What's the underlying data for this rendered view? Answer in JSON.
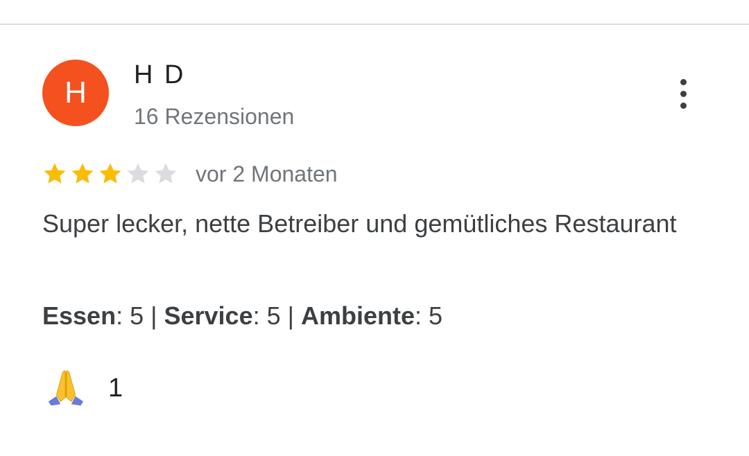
{
  "review": {
    "author": {
      "initial": "H",
      "name": "H D",
      "review_count": "16 Rezensionen",
      "avatar_color": "#f4511e"
    },
    "menu_icon": "more-vert-icon",
    "rating": {
      "value": 3,
      "max": 5,
      "filled_color": "#fbbc04",
      "empty_color": "#dadce0"
    },
    "relative_time": "vor 2 Monaten",
    "text": "Super lecker, nette Betreiber und gemütliches Restaurant",
    "sub_ratings": [
      {
        "label": "Essen",
        "value": "5"
      },
      {
        "label": "Service",
        "value": "5"
      },
      {
        "label": "Ambiente",
        "value": "5"
      }
    ],
    "reaction": {
      "icon": "folded-hands-icon",
      "count": "1"
    }
  }
}
